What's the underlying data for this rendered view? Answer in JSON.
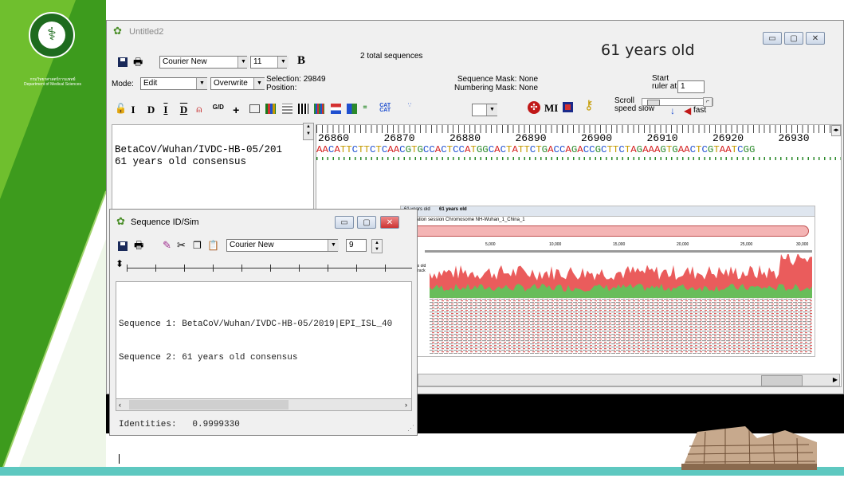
{
  "slide": {
    "logo_caption": "กรมวิทยาศาสตร์การแพทย์",
    "logo_caption_en": "Department of Medical Sciences"
  },
  "main_window": {
    "title": "Untitled2",
    "heading": "61 years old",
    "total_sequences": "2 total sequences",
    "font_name": "Courier New",
    "font_size": "11",
    "bold_label": "B",
    "mode_label": "Mode:",
    "mode_value": "Edit",
    "overwrite_value": "Overwrite",
    "selection": "Selection: 29849",
    "position": "Position:",
    "sequence_mask": "Sequence Mask: None",
    "numbering_mask": "Numbering Mask: None",
    "start_ruler": "Start",
    "ruler_at": "ruler at:",
    "ruler_value": "1",
    "scroll_label": "Scroll",
    "speed_label": "speed",
    "slow_label": "slow",
    "fast_label": "fast",
    "toolbar_text_icons": [
      "I",
      "D",
      "I",
      "D",
      "G/D",
      "MI"
    ],
    "ruler_numbers": [
      "26860",
      "26870",
      "26880",
      "26890",
      "26900",
      "26910",
      "26920",
      "26930"
    ],
    "sequence_names": [
      "BetaCoV/Wuhan/IVDC-HB-05/201",
      "61 years old consensus"
    ],
    "sequence_row": "AACATTCTTCTCAACGTGCCACTCCATGGCACTATTCTGACCAGACCGCTTCTAGAAAGTGAACTCGTAATCGG",
    "nucleotide_colors": {
      "A": "#d42020",
      "C": "#1f4fcf",
      "G": "#2b8a2b",
      "T": "#c49a00"
    }
  },
  "sim_window": {
    "title": "Sequence ID/Sim",
    "font_name": "Courier New",
    "font_size": "9",
    "lines": [
      "Sequence 1: BetaCoV/Wuhan/IVDC-HB-05/2019|EPI_ISL_40",
      "Sequence 2: 61 years old consensus",
      "",
      "Identities:   0.9999330"
    ]
  },
  "genome_view": {
    "tabs": [
      "61 years old",
      "61 years old"
    ],
    "track_title": "Navigation session Chromosome NH-Wuhan_1_China_1",
    "axis_ticks": [
      "5,000",
      "10,000",
      "15,000",
      "20,000",
      "25,000",
      "30,000"
    ],
    "track_label": "61 years old",
    "track_sublabel": "5 SNP track"
  },
  "colors": {
    "slide_green": "#3d9b1d",
    "slide_teal": "#5ec8c0",
    "coverage_red": "#e84a4a",
    "coverage_green": "#5ac85a"
  }
}
